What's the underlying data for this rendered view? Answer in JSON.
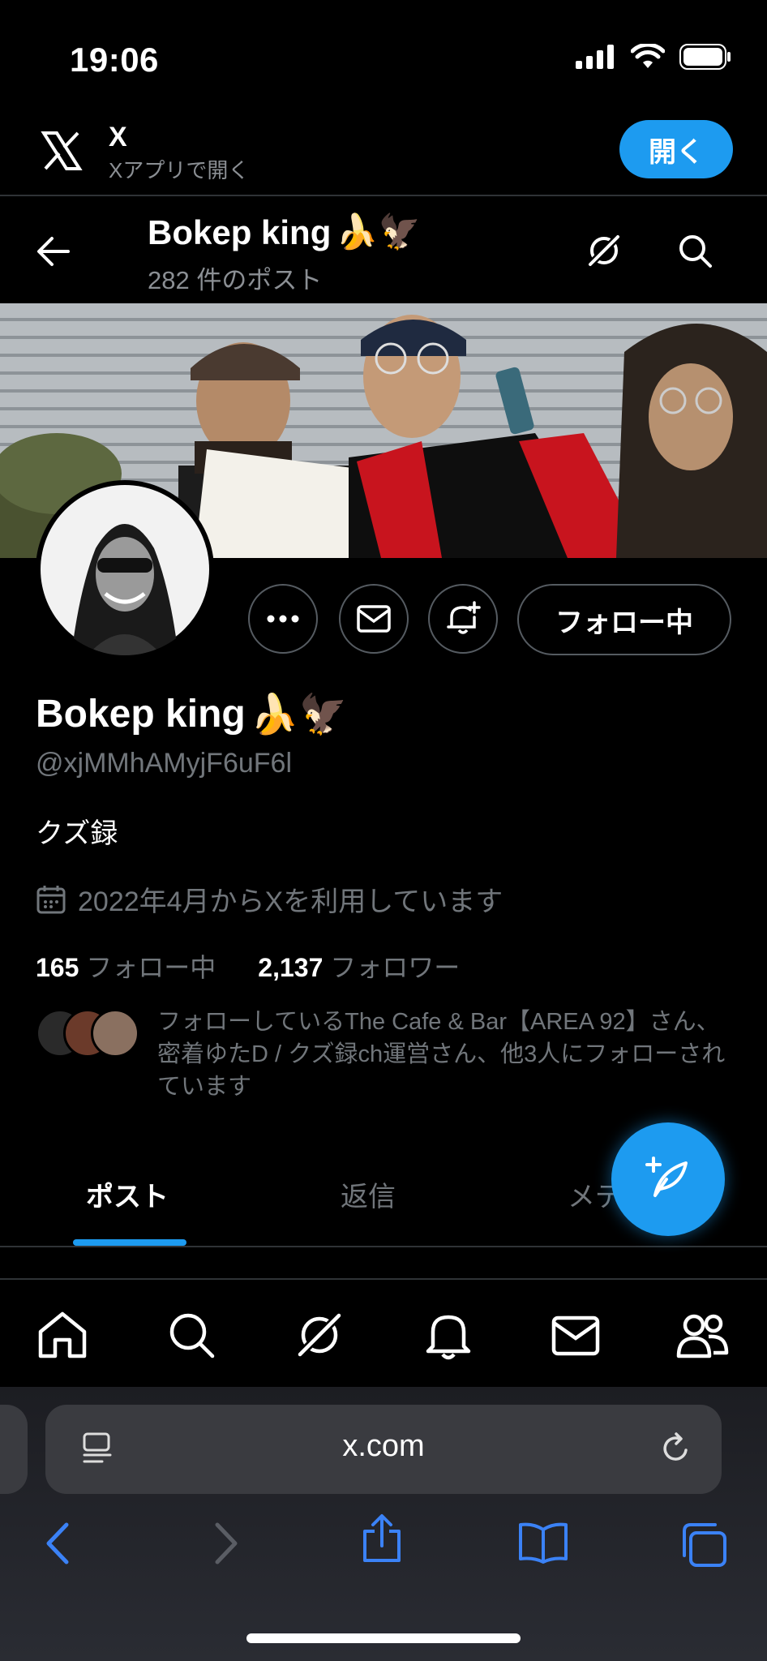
{
  "status_bar": {
    "time": "19:06"
  },
  "app_banner": {
    "title": "X",
    "subtitle": "Xアプリで開く",
    "open_label": "開く"
  },
  "profile_header": {
    "name": "Bokep king",
    "name_emojis": "🍌🦅",
    "posts_count": "282 件のポスト"
  },
  "profile": {
    "display_name": "Bokep king",
    "display_name_emojis": "🍌🦅",
    "handle": "@xjMMhAMyjF6uF6l",
    "bio": "クズ録",
    "joined": "2022年4月からXを利用しています",
    "following_count": "165",
    "following_label": "フォロー中",
    "followers_count": "2,137",
    "followers_label": "フォロワー",
    "followed_by": "フォローしているThe Cafe & Bar【AREA 92】さん、密着ゆたD / クズ録ch運営さん、他3人にフォローされています",
    "follow_button": "フォロー中"
  },
  "tabs": [
    {
      "label": "ポスト",
      "active": true
    },
    {
      "label": "返信",
      "active": false
    },
    {
      "label": "メデ",
      "active": false
    }
  ],
  "bottom_nav": [
    "home-icon",
    "search-icon",
    "grok-icon",
    "notifications-icon",
    "messages-icon",
    "communities-icon"
  ],
  "safari": {
    "url": "x.com"
  },
  "colors": {
    "accent": "#1d9bf0",
    "muted": "#71767b",
    "background": "#000000"
  }
}
